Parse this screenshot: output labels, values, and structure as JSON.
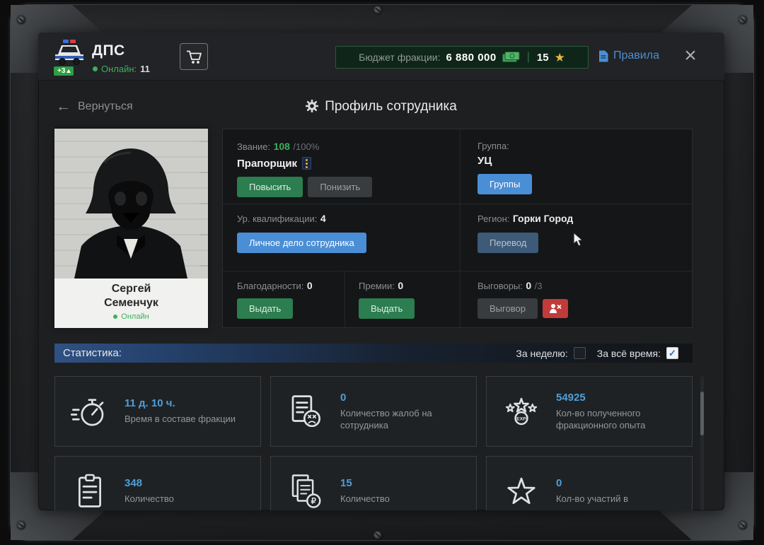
{
  "header": {
    "faction_name": "ДПС",
    "member_badge": "+3",
    "online_label": "Онлайн:",
    "online_count": "11",
    "budget_label": "Бюджет фракции:",
    "budget_value": "6 880 000",
    "stars_value": "15",
    "rules_label": "Правила"
  },
  "toolbar": {
    "back_label": "Вернуться",
    "title": "Профиль сотрудника"
  },
  "employee": {
    "first_name": "Сергей",
    "last_name": "Семенчук",
    "status": "Онлайн"
  },
  "panel": {
    "rank": {
      "label": "Звание:",
      "value": "108",
      "suffix": "/100%",
      "name": "Прапорщик",
      "promote_label": "Повысить",
      "demote_label": "Понизить"
    },
    "group": {
      "label": "Группа:",
      "value": "УЦ",
      "button_label": "Группы"
    },
    "qualification": {
      "label": "Ур. квалификации:",
      "value": "4",
      "button_label": "Личное дело сотрудника"
    },
    "region": {
      "label": "Регион:",
      "value": "Горки Город",
      "button_label": "Перевод"
    },
    "thanks": {
      "label": "Благодарности:",
      "value": "0",
      "button_label": "Выдать"
    },
    "bonus": {
      "label": "Премии:",
      "value": "0",
      "button_label": "Выдать"
    },
    "reprimand": {
      "label": "Выговоры:",
      "value": "0",
      "suffix": "/3",
      "button_label": "Выговор"
    }
  },
  "statistics": {
    "title": "Статистика:",
    "filter_week_label": "За неделю:",
    "filter_week_checked": false,
    "filter_alltime_label": "За всё время:",
    "filter_alltime_checked": true,
    "cards": [
      {
        "icon": "stopwatch-icon",
        "value": "11 д. 10 ч.",
        "label": "Время в составе фракции"
      },
      {
        "icon": "complaint-document-icon",
        "value": "0",
        "label": "Количество жалоб на сотрудника"
      },
      {
        "icon": "exp-stars-icon",
        "value": "54925",
        "label": "Кол-во полученного фракционного опыта"
      },
      {
        "icon": "clipboard-icon",
        "value": "348",
        "label": "Количество"
      },
      {
        "icon": "ruble-documents-icon",
        "value": "15",
        "label": "Количество"
      },
      {
        "icon": "star-icon",
        "value": "0",
        "label": "Кол-во участий в"
      }
    ]
  },
  "glyphs": {
    "back_arrow": "←",
    "close": "×",
    "star": "★",
    "check": "✓",
    "budget_separator": "|"
  },
  "colors": {
    "accent_green": "#3fae5e",
    "accent_blue": "#4d8fd2",
    "stat_blue": "#4f9fd9",
    "danger_red": "#c23a3a",
    "gold": "#e8b93a"
  }
}
